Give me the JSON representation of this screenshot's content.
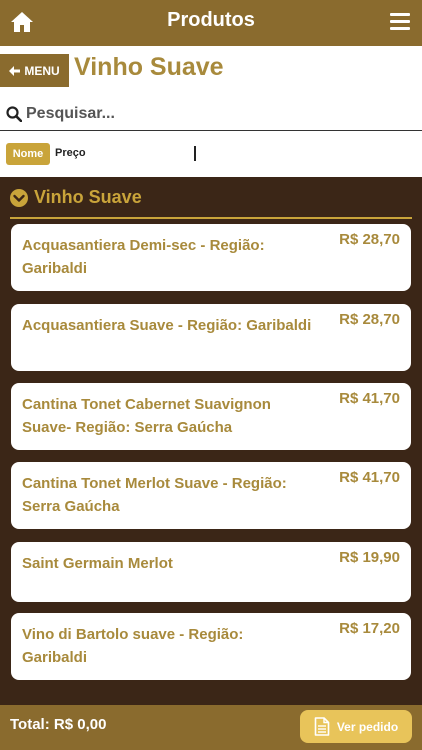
{
  "header": {
    "title": "Produtos",
    "home_icon": "home-icon",
    "menu_icon": "hamburger-icon"
  },
  "nav": {
    "menu_label": "MENU",
    "page_title": "Vinho Suave"
  },
  "search": {
    "placeholder": "Pesquisar..."
  },
  "sort": {
    "options": [
      "Nome",
      "Preço"
    ],
    "active": "Nome"
  },
  "section": {
    "title": "Vinho Suave"
  },
  "products": [
    {
      "name": "Acquasantiera Demi-sec - Região: Garibaldi",
      "price": "R$ 28,70"
    },
    {
      "name": "Acquasantiera Suave - Região: Garibaldi",
      "price": "R$ 28,70"
    },
    {
      "name": "Cantina Tonet Cabernet Suavignon Suave- Região: Serra Gaúcha",
      "price": "R$ 41,70"
    },
    {
      "name": "Cantina Tonet Merlot Suave - Região: Serra Gaúcha",
      "price": "R$ 41,70"
    },
    {
      "name": "Saint Germain Merlot",
      "price": "R$ 19,90"
    },
    {
      "name": "Vino di Bartolo suave - Região: Garibaldi",
      "price": "R$ 17,20"
    }
  ],
  "footer": {
    "total": "Total: R$ 0,00",
    "order_label": "Ver pedido"
  },
  "colors": {
    "brand": "#8a6b2e",
    "accent": "#c9a43a",
    "text_gold": "#a88a3c",
    "background_dark": "#3b2617"
  }
}
